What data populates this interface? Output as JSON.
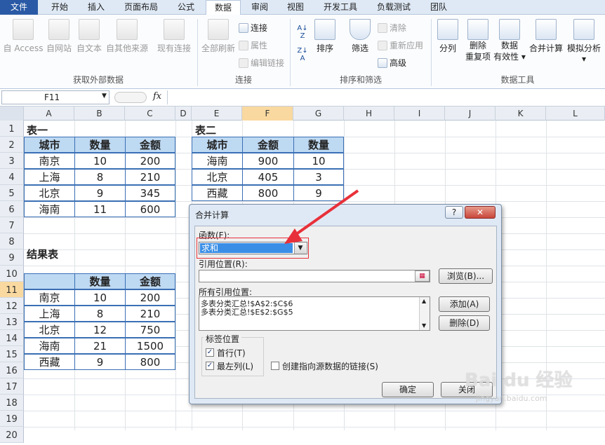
{
  "tabs": [
    {
      "label": "文件"
    },
    {
      "label": "开始"
    },
    {
      "label": "插入"
    },
    {
      "label": "页面布局"
    },
    {
      "label": "公式"
    },
    {
      "label": "数据"
    },
    {
      "label": "审阅"
    },
    {
      "label": "视图"
    },
    {
      "label": "开发工具"
    },
    {
      "label": "负载测试"
    },
    {
      "label": "团队"
    }
  ],
  "ribbon": {
    "access": "自 Access",
    "web": "自网站",
    "text": "自文本",
    "other": "自其他来源",
    "existing": "现有连接",
    "refresh_all": "全部刷新",
    "connections": "连接",
    "properties": "属性",
    "edit_links": "编辑链接",
    "sort": "排序",
    "filter": "筛选",
    "clear": "清除",
    "reapply": "重新应用",
    "advanced": "高级",
    "text_to_columns": "分列",
    "remove_dup_1": "删除",
    "remove_dup_2": "重复项",
    "validation_1": "数据",
    "validation_2": "有效性",
    "consolidate": "合并计算",
    "whatif": "模拟分析",
    "group_external": "获取外部数据",
    "group_connections": "连接",
    "group_sort": "排序和筛选",
    "group_tools": "数据工具"
  },
  "formula_bar": {
    "name_box": "F11",
    "fx": "fx",
    "formula": ""
  },
  "columns": [
    "A",
    "B",
    "C",
    "D",
    "E",
    "F",
    "G",
    "H",
    "I",
    "J",
    "K",
    "L"
  ],
  "rows": [
    "1",
    "2",
    "3",
    "4",
    "5",
    "6",
    "7",
    "8",
    "9",
    "10",
    "11",
    "12",
    "13",
    "14",
    "15",
    "16",
    "17",
    "18",
    "19",
    "20"
  ],
  "selected": {
    "column": "F",
    "row": "11"
  },
  "sheet": {
    "table1_title": "表一",
    "table1_headers": [
      "城市",
      "数量",
      "金额"
    ],
    "table1_rows": [
      [
        "南京",
        "10",
        "200"
      ],
      [
        "上海",
        "8",
        "210"
      ],
      [
        "北京",
        "9",
        "345"
      ],
      [
        "海南",
        "11",
        "600"
      ]
    ],
    "table2_title": "表二",
    "table2_headers": [
      "城市",
      "金额",
      "数量"
    ],
    "table2_rows": [
      [
        "海南",
        "900",
        "10"
      ],
      [
        "北京",
        "405",
        "3"
      ],
      [
        "西藏",
        "800",
        "9"
      ]
    ],
    "result_title": "结果表",
    "result_headers": [
      "",
      "数量",
      "金额"
    ],
    "result_rows": [
      [
        "南京",
        "10",
        "200"
      ],
      [
        "上海",
        "8",
        "210"
      ],
      [
        "北京",
        "12",
        "750"
      ],
      [
        "海南",
        "21",
        "1500"
      ],
      [
        "西藏",
        "9",
        "800"
      ]
    ]
  },
  "dialog": {
    "title": "合并计算",
    "help": "?",
    "close": "✕",
    "function_label": "函数(F):",
    "function_value": "求和",
    "ref_label": "引用位置(R):",
    "ref_value": "",
    "browse": "浏览(B)...",
    "all_refs_label": "所有引用位置:",
    "all_refs": [
      "多表分类汇总!$A$2:$C$6",
      "多表分类汇总!$E$2:$G$5"
    ],
    "add": "添加(A)",
    "delete": "删除(D)",
    "labels_group": "标签位置",
    "top_row": "首行(T)",
    "top_row_checked": true,
    "left_col": "最左列(L)",
    "left_col_checked": true,
    "create_links": "创建指向源数据的链接(S)",
    "create_links_checked": false,
    "ok": "确定",
    "cancel": "关闭"
  },
  "watermark": {
    "line1": "Bai du 经验",
    "line2": "jingyan.baidu.com"
  },
  "colors": {
    "accent": "#2a5aa5",
    "header_fill": "#bed9f2",
    "table_border": "#3a6fb4",
    "selection": "#f9d9a0",
    "annotation": "#e8303a",
    "combo_selected": "#3a8ee6"
  }
}
